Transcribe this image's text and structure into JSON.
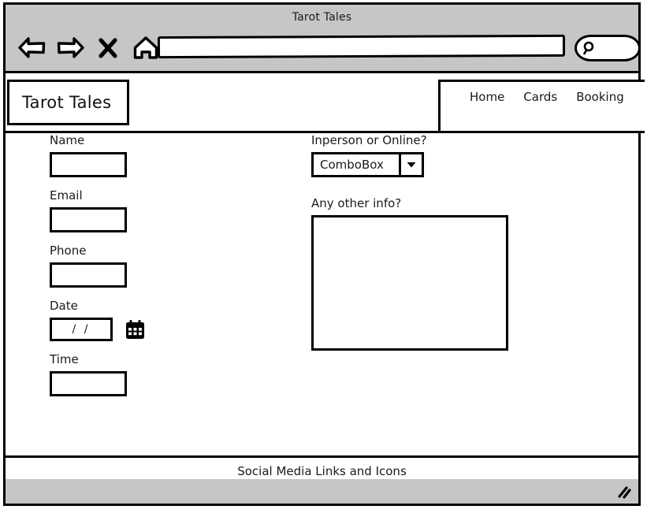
{
  "window": {
    "title": "Tarot Tales",
    "toolbar": {
      "back_icon": "back-arrow-icon",
      "forward_icon": "forward-arrow-icon",
      "stop_icon": "close-x-icon",
      "home_icon": "home-icon",
      "url_value": "",
      "url_placeholder": "",
      "search_icon": "search-magnifier-icon",
      "search_value": ""
    },
    "status": {
      "resize_grip_icon": "resize-grip-icon"
    }
  },
  "site": {
    "logo": "Tarot Tales",
    "nav": [
      {
        "label": "Home"
      },
      {
        "label": "Cards"
      },
      {
        "label": "Booking"
      }
    ]
  },
  "form": {
    "left": [
      {
        "label": "Name",
        "value": "",
        "type": "text"
      },
      {
        "label": "Email",
        "value": "",
        "type": "text"
      },
      {
        "label": "Phone",
        "value": "",
        "type": "text"
      },
      {
        "label": "Date",
        "value": "/  /",
        "type": "date",
        "icon": "calendar-icon"
      },
      {
        "label": "Time",
        "value": "",
        "type": "text"
      }
    ],
    "right": {
      "mode_label": "Inperson or Online?",
      "mode_value": "ComboBox",
      "mode_arrow_icon": "chevron-down-icon",
      "info_label": "Any other info?",
      "info_value": ""
    }
  },
  "footer": {
    "text": "Social Media Links and Icons"
  },
  "colors": {
    "chrome": "#c6c6c6",
    "ink": "#000000",
    "page": "#ffffff"
  }
}
